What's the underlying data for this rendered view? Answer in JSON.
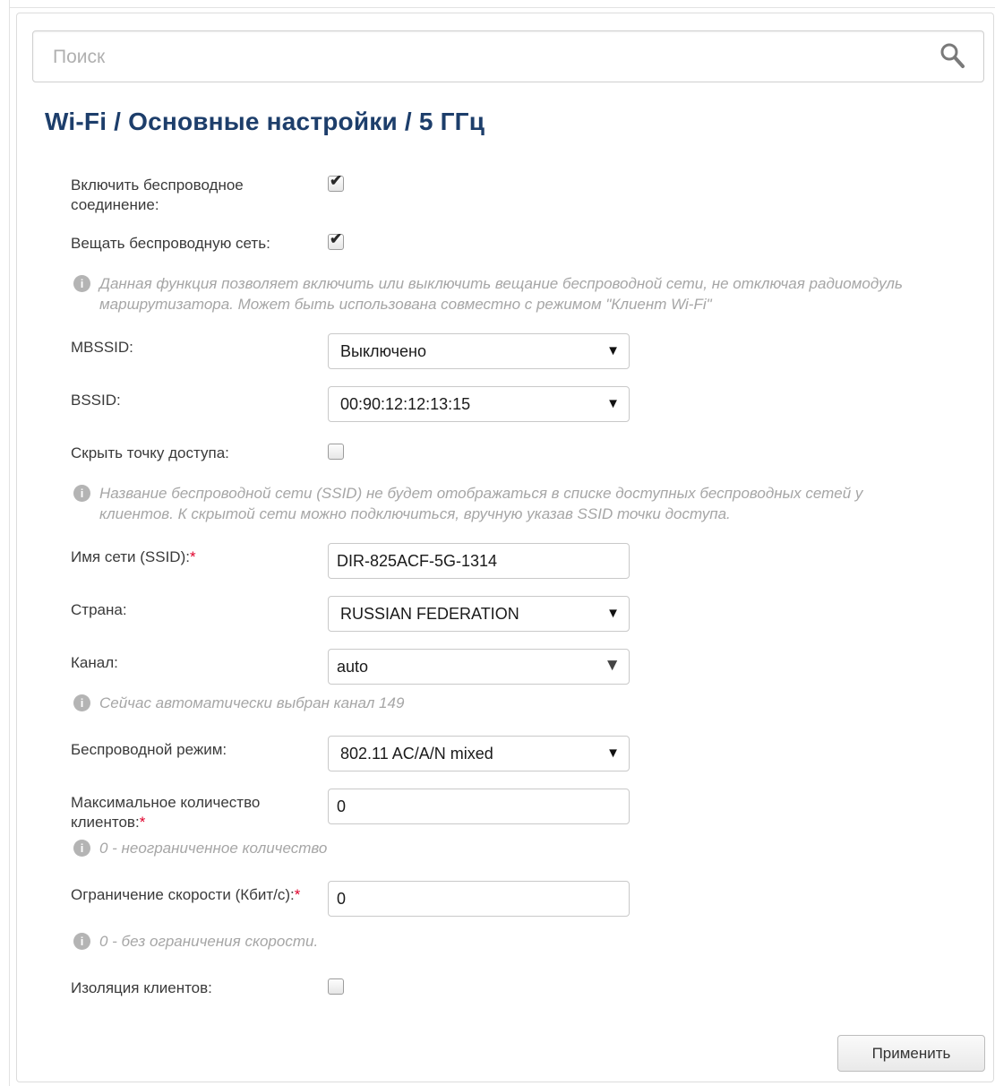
{
  "search": {
    "placeholder": "Поиск"
  },
  "page_title": "Wi-Fi /  Основные настройки /  5 ГГц",
  "fields": {
    "enable_wireless": {
      "label": "Включить беспроводное соединение:",
      "checked": true
    },
    "broadcast": {
      "label": "Вещать беспроводную сеть:",
      "checked": true
    },
    "broadcast_hint": "Данная функция позволяет включить или выключить вещание беспроводной сети, не отключая радиомодуль маршрутизатора. Может быть использована совместно с режимом \"Клиент Wi-Fi\"",
    "mbssid": {
      "label": "MBSSID:",
      "value": "Выключено"
    },
    "bssid": {
      "label": "BSSID:",
      "value": "00:90:12:12:13:15"
    },
    "hide_ap": {
      "label": "Скрыть точку доступа:",
      "checked": false
    },
    "hide_ap_hint": "Название беспроводной сети (SSID) не будет отображаться в списке доступных беспроводных сетей у клиентов. К скрытой сети можно подключиться, вручную указав SSID точки доступа.",
    "ssid": {
      "label": "Имя сети (SSID):",
      "required": "*",
      "value": "DIR-825ACF-5G-1314"
    },
    "country": {
      "label": "Страна:",
      "value": "RUSSIAN FEDERATION"
    },
    "channel": {
      "label": "Канал:",
      "value": "auto"
    },
    "channel_hint": "Сейчас автоматически выбран канал 149",
    "wireless_mode": {
      "label": "Беспроводной режим:",
      "value": "802.11 AC/A/N mixed"
    },
    "max_clients": {
      "label": "Максимальное количество клиентов:",
      "required": "*",
      "value": "0"
    },
    "max_clients_hint": "0 - неограниченное количество",
    "speed_limit": {
      "label": "Ограничение скорости (Кбит/с):",
      "required": "*",
      "value": "0"
    },
    "speed_limit_hint": "0 - без ограничения скорости.",
    "isolation": {
      "label": "Изоляция клиентов:",
      "checked": false
    }
  },
  "apply_label": "Применить",
  "icons": {
    "search": "search-icon",
    "info": "info-icon",
    "dropdown": "chevron-down-icon"
  }
}
